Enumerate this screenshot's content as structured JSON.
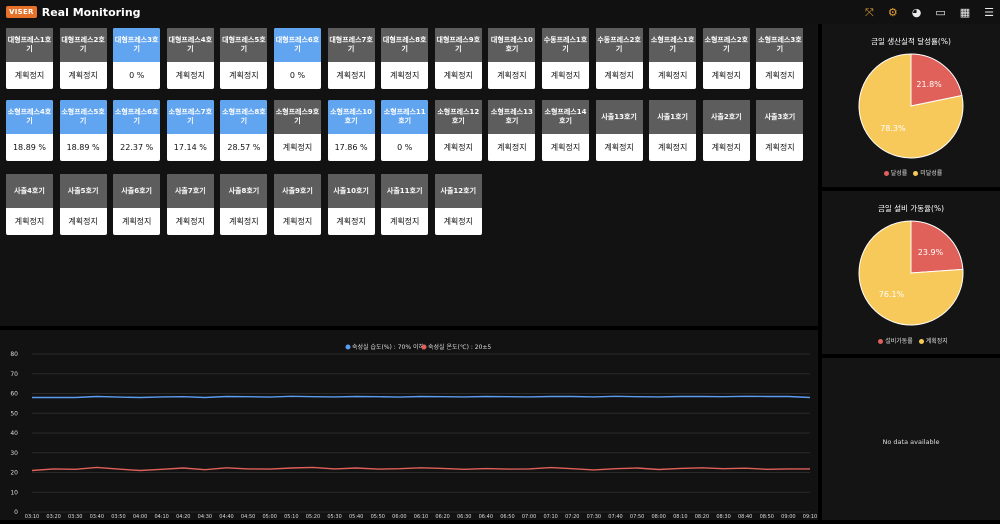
{
  "app": {
    "logo": "VISER",
    "title": "Real Monitoring"
  },
  "toolbar": {
    "icons": [
      "expand-icon",
      "gears-icon",
      "pie-chart-icon",
      "monitor-icon",
      "grid-icon",
      "list-icon"
    ]
  },
  "machines": [
    {
      "name": "대형프레스1호기",
      "value": "계획정지",
      "active": false
    },
    {
      "name": "대형프레스2호기",
      "value": "계획정지",
      "active": false
    },
    {
      "name": "대형프레스3호기",
      "value": "0 %",
      "active": true
    },
    {
      "name": "대형프레스4호기",
      "value": "계획정지",
      "active": false
    },
    {
      "name": "대형프레스5호기",
      "value": "계획정지",
      "active": false
    },
    {
      "name": "대형프레스6호기",
      "value": "0 %",
      "active": true
    },
    {
      "name": "대형프레스7호기",
      "value": "계획정지",
      "active": false
    },
    {
      "name": "대형프레스8호기",
      "value": "계획정지",
      "active": false
    },
    {
      "name": "대형프레스9호기",
      "value": "계획정지",
      "active": false
    },
    {
      "name": "대형프레스10호기",
      "value": "계획정지",
      "active": false
    },
    {
      "name": "수동프레스1호기",
      "value": "계획정지",
      "active": false
    },
    {
      "name": "수동프레스2호기",
      "value": "계획정지",
      "active": false
    },
    {
      "name": "소형프레스1호기",
      "value": "계획정지",
      "active": false
    },
    {
      "name": "소형프레스2호기",
      "value": "계획정지",
      "active": false
    },
    {
      "name": "소형프레스3호기",
      "value": "계획정지",
      "active": false
    },
    {
      "name": "소형프레스4호기",
      "value": "18.89 %",
      "active": true
    },
    {
      "name": "소형프레스5호기",
      "value": "18.89 %",
      "active": true
    },
    {
      "name": "소형프레스6호기",
      "value": "22.37 %",
      "active": true
    },
    {
      "name": "소형프레스7호기",
      "value": "17.14 %",
      "active": true
    },
    {
      "name": "소형프레스8호기",
      "value": "28.57 %",
      "active": true
    },
    {
      "name": "소형프레스9호기",
      "value": "계획정지",
      "active": false
    },
    {
      "name": "소형프레스10호기",
      "value": "17.86 %",
      "active": true
    },
    {
      "name": "소형프레스11호기",
      "value": "0 %",
      "active": true
    },
    {
      "name": "소형프레스12호기",
      "value": "계획정지",
      "active": false
    },
    {
      "name": "소형프레스13호기",
      "value": "계획정지",
      "active": false
    },
    {
      "name": "소형프레스14호기",
      "value": "계획정지",
      "active": false
    },
    {
      "name": "사출13호기",
      "value": "계획정지",
      "active": false
    },
    {
      "name": "사출1호기",
      "value": "계획정지",
      "active": false
    },
    {
      "name": "사출2호기",
      "value": "계획정지",
      "active": false
    },
    {
      "name": "사출3호기",
      "value": "계획정지",
      "active": false
    },
    {
      "name": "사출4호기",
      "value": "계획정지",
      "active": false
    },
    {
      "name": "사출5호기",
      "value": "계획정지",
      "active": false
    },
    {
      "name": "사출6호기",
      "value": "계획정지",
      "active": false
    },
    {
      "name": "사출7호기",
      "value": "계획정지",
      "active": false
    },
    {
      "name": "사출8호기",
      "value": "계획정지",
      "active": false
    },
    {
      "name": "사출9호기",
      "value": "계획정지",
      "active": false
    },
    {
      "name": "사출10호기",
      "value": "계획정지",
      "active": false
    },
    {
      "name": "사출11호기",
      "value": "계획정지",
      "active": false
    },
    {
      "name": "사출12호기",
      "value": "계획정지",
      "active": false
    }
  ],
  "colors": {
    "active": "#61a4ef",
    "inactive": "#5d5d5d",
    "red": "#e0605a",
    "yellow": "#f7c95a",
    "blue": "#5b9cf0"
  },
  "chart_data": [
    {
      "type": "line",
      "title": "",
      "xlabel": "",
      "ylabel": "",
      "ylim": [
        0,
        80
      ],
      "yticks": [
        0,
        10,
        20,
        30,
        40,
        50,
        60,
        70,
        80
      ],
      "x": [
        "03:10",
        "03:20",
        "03:30",
        "03:40",
        "03:50",
        "04:00",
        "04:10",
        "04:20",
        "04:30",
        "04:40",
        "04:50",
        "05:00",
        "05:10",
        "05:20",
        "05:30",
        "05:40",
        "05:50",
        "06:00",
        "06:10",
        "06:20",
        "06:30",
        "06:40",
        "06:50",
        "07:00",
        "07:10",
        "07:20",
        "07:30",
        "07:40",
        "07:50",
        "08:00",
        "08:10",
        "08:20",
        "08:30",
        "08:40",
        "08:50",
        "09:00",
        "09:10"
      ],
      "grid": true,
      "legend_position": "top",
      "series": [
        {
          "name": "숙성실 습도(%) : 70% 이하",
          "color": "#5b9cf0",
          "values": [
            58,
            58,
            58,
            58.5,
            58.2,
            58,
            58.3,
            58.4,
            58,
            58.5,
            58.4,
            58.2,
            58.6,
            58.4,
            58.3,
            58.5,
            58.4,
            58.2,
            58.5,
            58.4,
            58.3,
            58.5,
            58.4,
            58.3,
            58.5,
            58.5,
            58.3,
            58.6,
            58.4,
            58.3,
            58.5,
            58.5,
            58.4,
            58.6,
            58.5,
            58.5,
            58
          ]
        },
        {
          "name": "숙성실 온도(℃) : 20±5",
          "color": "#e0605a",
          "values": [
            21,
            21.8,
            21.6,
            22.6,
            21.7,
            21,
            21.6,
            22.3,
            21.4,
            22.4,
            21.8,
            21.7,
            22.3,
            22.6,
            21.8,
            22.3,
            21.7,
            21.9,
            22.4,
            22.1,
            21.6,
            22,
            21.7,
            21.8,
            22.5,
            21.9,
            21.3,
            21.9,
            22.3,
            21.5,
            22.1,
            22.4,
            21.9,
            22.2,
            21.6,
            21.8,
            21.8
          ]
        }
      ]
    },
    {
      "type": "pie",
      "title": "금일 생산실적 달성률(%)",
      "slices": [
        {
          "label": "달성률",
          "value": 21.8,
          "display": "21.8%",
          "color": "#e0605a"
        },
        {
          "label": "미달성률",
          "value": 78.3,
          "display": "78.3%",
          "color": "#f7c95a"
        }
      ]
    },
    {
      "type": "pie",
      "title": "금일 설비 가동율(%)",
      "slices": [
        {
          "label": "설비가동률",
          "value": 23.9,
          "display": "23.9%",
          "color": "#e0605a"
        },
        {
          "label": "계획정지",
          "value": 76.1,
          "display": "76.1%",
          "color": "#f7c95a"
        }
      ]
    }
  ],
  "empty_panel": {
    "message": "No data available"
  }
}
